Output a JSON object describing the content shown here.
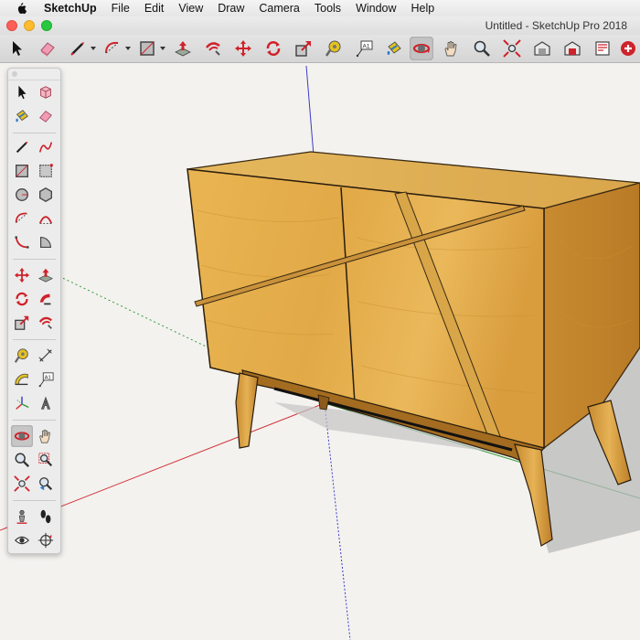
{
  "menubar": {
    "app_name": "SketchUp",
    "menus": [
      "File",
      "Edit",
      "View",
      "Draw",
      "Camera",
      "Tools",
      "Window",
      "Help"
    ]
  },
  "window": {
    "title": "Untitled - SketchUp Pro 2018"
  },
  "colors": {
    "close": "#fe5f57",
    "minimize": "#febc2e",
    "maximize": "#28c840",
    "axis_red": "#d4343a",
    "axis_green": "#2f9a3c",
    "axis_blue": "#3b3bc8",
    "wood_light": "#e4ad45",
    "wood_dark": "#bf832a",
    "tool_red": "#d0222a",
    "tool_yellow": "#e6c21e"
  },
  "toolbar": {
    "tools": [
      {
        "name": "select-tool-icon"
      },
      {
        "name": "eraser-tool-icon"
      },
      {
        "name": "line-tool-icon",
        "dropdown": true
      },
      {
        "name": "arc-tool-icon",
        "dropdown": true
      },
      {
        "name": "rectangle-tool-icon",
        "dropdown": true
      },
      {
        "name": "push-pull-tool-icon"
      },
      {
        "name": "offset-tool-icon"
      },
      {
        "name": "move-tool-icon"
      },
      {
        "name": "rotate-tool-icon"
      },
      {
        "name": "scale-tool-icon"
      },
      {
        "name": "tape-measure-tool-icon"
      },
      {
        "name": "text-tool-icon",
        "text": "A1"
      },
      {
        "name": "paint-bucket-tool-icon"
      },
      {
        "name": "orbit-tool-icon",
        "active": true
      },
      {
        "name": "pan-tool-icon"
      },
      {
        "name": "zoom-tool-icon"
      },
      {
        "name": "zoom-extents-tool-icon"
      },
      {
        "name": "warehouse-icon"
      },
      {
        "name": "extension-warehouse-icon"
      },
      {
        "name": "layout-icon"
      },
      {
        "name": "extension-manager-icon"
      }
    ]
  },
  "tool_palette": {
    "tools": [
      {
        "name": "select-tool-icon"
      },
      {
        "name": "make-component-icon"
      },
      {
        "name": "paint-bucket-tool-icon"
      },
      {
        "name": "eraser-tool-icon"
      },
      {
        "name": "line-tool-icon"
      },
      {
        "name": "freehand-tool-icon"
      },
      {
        "name": "rectangle-tool-icon"
      },
      {
        "name": "rotated-rectangle-tool-icon"
      },
      {
        "name": "circle-tool-icon"
      },
      {
        "name": "polygon-tool-icon"
      },
      {
        "name": "arc-tool-icon"
      },
      {
        "name": "two-point-arc-tool-icon"
      },
      {
        "name": "three-point-arc-tool-icon"
      },
      {
        "name": "pie-tool-icon"
      },
      {
        "name": "move-tool-icon"
      },
      {
        "name": "push-pull-tool-icon"
      },
      {
        "name": "rotate-tool-icon"
      },
      {
        "name": "follow-me-tool-icon"
      },
      {
        "name": "scale-tool-icon"
      },
      {
        "name": "offset-tool-icon"
      },
      {
        "name": "tape-measure-tool-icon"
      },
      {
        "name": "dimension-tool-icon"
      },
      {
        "name": "protractor-tool-icon"
      },
      {
        "name": "text-tool-icon",
        "text": "A1"
      },
      {
        "name": "axes-tool-icon"
      },
      {
        "name": "3d-text-tool-icon"
      },
      {
        "name": "orbit-tool-icon",
        "active": true
      },
      {
        "name": "pan-tool-icon"
      },
      {
        "name": "zoom-tool-icon"
      },
      {
        "name": "zoom-window-tool-icon"
      },
      {
        "name": "zoom-extents-tool-icon"
      },
      {
        "name": "previous-view-icon"
      },
      {
        "name": "position-camera-tool-icon"
      },
      {
        "name": "walk-tool-icon"
      },
      {
        "name": "look-around-tool-icon"
      },
      {
        "name": "section-plane-tool-icon"
      }
    ]
  }
}
